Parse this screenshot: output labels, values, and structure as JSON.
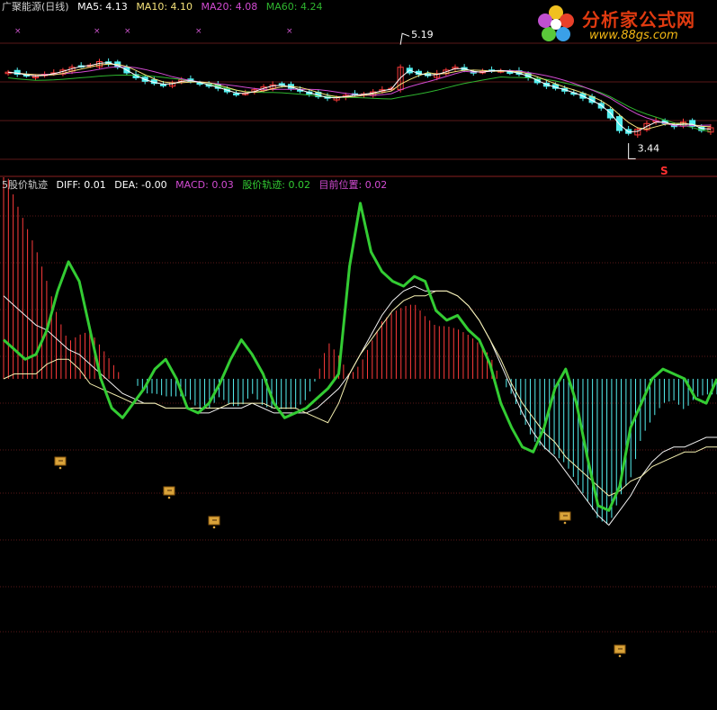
{
  "header_top": {
    "name": "广聚能源(日线)",
    "ma5": "MA5: 4.13",
    "ma10": "MA10: 4.10",
    "ma20": "MA20: 4.08",
    "ma60": "MA60: 4.24"
  },
  "header_bottom": {
    "name": "5股价轨迹",
    "diff": "DIFF: 0.01",
    "dea": "DEA: -0.00",
    "macd": "MACD: 0.03",
    "track": "股价轨迹: 0.02",
    "position": "目前位置: 0.02"
  },
  "logo": {
    "title": "分析家公式网",
    "url": "www.88gs.com"
  },
  "colors": {
    "ma5": "#ffffff",
    "ma10": "#f5e27a",
    "ma20": "#d24bd2",
    "ma60": "#2fb52f",
    "up_candle": "#ff3b3b",
    "down_candle": "#55f0f0",
    "track": "#33cc33",
    "grid": "#5a1818",
    "macd_pos": "#ff3b3b",
    "macd_neg": "#55f0f0",
    "signal": "#d9a33a"
  },
  "chart_data": [
    {
      "type": "candlestick",
      "annotations": [
        {
          "text": "5.19",
          "kind": "high"
        },
        {
          "text": "3.44",
          "kind": "low"
        },
        {
          "text": "S",
          "kind": "sell-marker"
        }
      ],
      "ylim": [
        3.2,
        5.4
      ],
      "close": [
        4.63,
        4.6,
        4.58,
        4.57,
        4.6,
        4.62,
        4.66,
        4.7,
        4.72,
        4.73,
        4.78,
        4.75,
        4.7,
        4.62,
        4.55,
        4.5,
        4.47,
        4.45,
        4.48,
        4.52,
        4.5,
        4.47,
        4.43,
        4.4,
        4.35,
        4.32,
        4.33,
        4.38,
        4.42,
        4.45,
        4.44,
        4.4,
        4.36,
        4.32,
        4.28,
        4.26,
        4.27,
        4.3,
        4.31,
        4.32,
        4.35,
        4.38,
        4.4,
        4.7,
        4.62,
        4.6,
        4.58,
        4.61,
        4.66,
        4.7,
        4.66,
        4.62,
        4.64,
        4.66,
        4.65,
        4.63,
        4.6,
        4.55,
        4.48,
        4.43,
        4.4,
        4.36,
        4.32,
        4.26,
        4.2,
        4.12,
        3.98,
        3.8,
        3.76,
        3.82,
        3.9,
        3.94,
        3.9,
        3.86,
        3.92,
        3.86,
        3.8,
        3.84
      ]
    },
    {
      "type": "macd",
      "series": [
        {
          "name": "股价轨迹",
          "values": [
            0.08,
            0.06,
            0.04,
            0.05,
            0.1,
            0.18,
            0.24,
            0.2,
            0.1,
            0.0,
            -0.06,
            -0.08,
            -0.05,
            -0.02,
            0.02,
            0.04,
            0.0,
            -0.06,
            -0.07,
            -0.05,
            -0.01,
            0.04,
            0.08,
            0.05,
            0.01,
            -0.05,
            -0.08,
            -0.07,
            -0.06,
            -0.04,
            -0.02,
            0.01,
            0.23,
            0.36,
            0.26,
            0.22,
            0.2,
            0.19,
            0.21,
            0.2,
            0.14,
            0.12,
            0.13,
            0.1,
            0.08,
            0.03,
            -0.05,
            -0.1,
            -0.14,
            -0.15,
            -0.1,
            -0.02,
            0.02,
            -0.05,
            -0.16,
            -0.26,
            -0.27,
            -0.22,
            -0.1,
            -0.05,
            0.0,
            0.02,
            0.01,
            0.0,
            -0.04,
            -0.05,
            0.0
          ]
        },
        {
          "name": "DIFF",
          "values": [
            0.17,
            0.15,
            0.13,
            0.11,
            0.1,
            0.08,
            0.06,
            0.05,
            0.03,
            0.01,
            -0.01,
            -0.03,
            -0.04,
            -0.05,
            -0.05,
            -0.06,
            -0.06,
            -0.06,
            -0.07,
            -0.07,
            -0.06,
            -0.06,
            -0.06,
            -0.05,
            -0.06,
            -0.07,
            -0.07,
            -0.07,
            -0.07,
            -0.06,
            -0.04,
            -0.02,
            0.01,
            0.05,
            0.09,
            0.13,
            0.16,
            0.18,
            0.19,
            0.18,
            0.18,
            0.18,
            0.17,
            0.15,
            0.12,
            0.08,
            0.03,
            -0.02,
            -0.07,
            -0.11,
            -0.14,
            -0.16,
            -0.19,
            -0.22,
            -0.25,
            -0.28,
            -0.3,
            -0.27,
            -0.24,
            -0.2,
            -0.17,
            -0.15,
            -0.14,
            -0.14,
            -0.13,
            -0.12,
            -0.12
          ]
        },
        {
          "name": "DEA",
          "values": [
            0.0,
            0.01,
            0.01,
            0.01,
            0.03,
            0.04,
            0.04,
            0.02,
            -0.01,
            -0.02,
            -0.03,
            -0.04,
            -0.05,
            -0.05,
            -0.05,
            -0.06,
            -0.06,
            -0.06,
            -0.06,
            -0.06,
            -0.06,
            -0.05,
            -0.05,
            -0.05,
            -0.05,
            -0.06,
            -0.06,
            -0.06,
            -0.07,
            -0.08,
            -0.09,
            -0.05,
            0.01,
            0.05,
            0.08,
            0.11,
            0.14,
            0.16,
            0.17,
            0.17,
            0.18,
            0.18,
            0.17,
            0.15,
            0.12,
            0.08,
            0.04,
            -0.01,
            -0.05,
            -0.08,
            -0.11,
            -0.13,
            -0.16,
            -0.18,
            -0.2,
            -0.22,
            -0.24,
            -0.23,
            -0.21,
            -0.2,
            -0.18,
            -0.17,
            -0.16,
            -0.15,
            -0.15,
            -0.14,
            -0.14
          ]
        }
      ],
      "ylim": [
        -0.62,
        0.38
      ]
    }
  ]
}
